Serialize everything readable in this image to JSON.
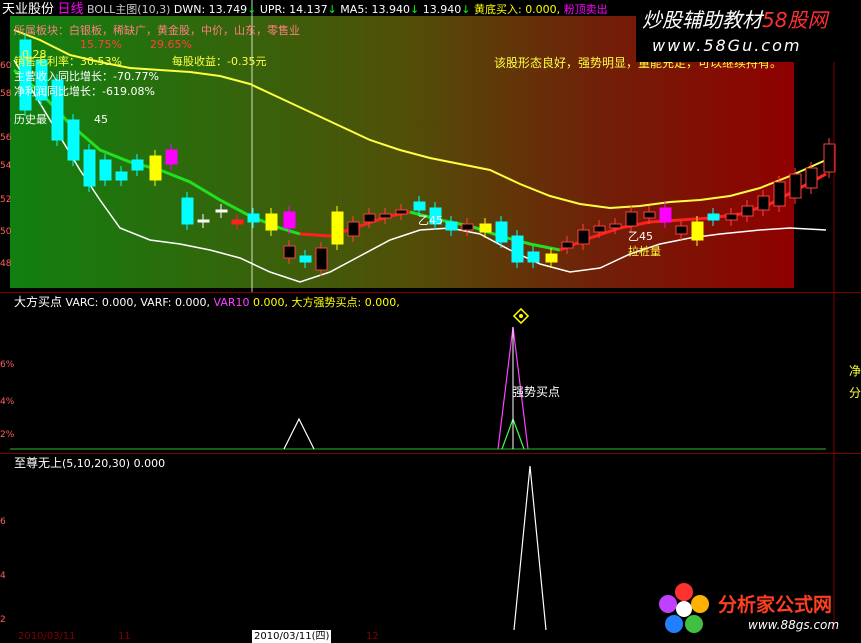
{
  "main_panel": {
    "stock_name": "天业股份",
    "period": "日线",
    "indicator": "BOLL主图(10,3)",
    "dwn_label": "DWN:",
    "dwn_value": "13.749",
    "upr_label": "UPR:",
    "upr_value": "14.137",
    "ma5_label": "MA5:",
    "ma5_value": "13.940",
    "ma5_value2": "13.940",
    "buy_label": "黄底买入:",
    "buy_value": "0.000,",
    "sell_label": "粉顶卖出",
    "sector_line": "所属板块：白银板，稀缺广，黄金股，中价，山东，零售业",
    "fragment_1": "0.28",
    "fragment_2": "15.75%",
    "fragment_3": "29.65%",
    "gross_margin": "销售毛利率：30.53%",
    "eps": "每股收益：-0.35元",
    "revenue_growth": "主营收入同比增长：-70.77%",
    "netprofit_growth": "净利润同比增长：-619.08%",
    "history_label": "历史最",
    "history_value": "45",
    "comment": "该股形态良好，强势明显，量能充足，可以继续持有。",
    "kline_label_1": "乙45",
    "kline_label_2": "拉桩量",
    "kline_label_3": "乙45"
  },
  "left_axis_main": [
    "60",
    "58",
    "56",
    "54",
    "52",
    "50",
    "48"
  ],
  "sub_panel_1": {
    "title": "大方买点",
    "varc_label": "VARC:",
    "varc_value": "0.000,",
    "varf_label": "VARF:",
    "varf_value": "0.000,",
    "var10_label": "VAR10",
    "var10_value": "0.000,",
    "strong_label": "大方强势买点:",
    "strong_value": "0.000,",
    "annotation": "强势买点",
    "right_axis": [
      "净",
      "分"
    ],
    "left_axis": [
      "6%",
      "4%",
      "2%"
    ]
  },
  "sub_panel_2": {
    "title": "至尊无上",
    "params": "(5,10,20,30)",
    "value": "0.000",
    "left_axis": [
      "6",
      "4",
      "2"
    ]
  },
  "bottom_bar": {
    "date_1": "2010/03/11",
    "date_highlight": "2010/03/11(四)",
    "label_1": "11",
    "label_2": "12"
  },
  "watermark_top": {
    "text_1": "炒股辅助教材",
    "text_2": "58股网",
    "url": "www.58Gu.com"
  },
  "watermark_bottom": {
    "text": "分析家公式网",
    "url": "www.88gs.com"
  },
  "colors": {
    "white": "#ffffff",
    "yellow": "#ffff00",
    "red": "#ff2020",
    "green": "#00ff00",
    "cyan": "#00ffff",
    "magenta": "#ff00ff",
    "axis_red": "#800000"
  }
}
